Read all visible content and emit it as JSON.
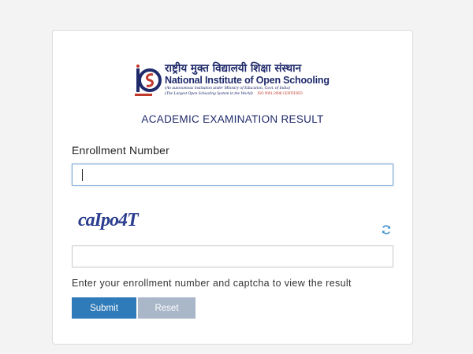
{
  "logo": {
    "hindi_name": "राष्ट्रीय मुक्त विद्यालयी शिक्षा संस्थान",
    "english_name": "National Institute of Open Schooling",
    "tagline": "(An autonomous institution under Ministry of Education, Govt. of India)",
    "tagline2": "(The Largest Open Schooling System in the World)",
    "iso": "ISO 9001:2008 CERTIFIED",
    "colors": {
      "navy": "#1f2a6b",
      "red": "#c0392b"
    }
  },
  "page": {
    "heading": "ACADEMIC EXAMINATION RESULT"
  },
  "form": {
    "enrollment_label": "Enrollment Number",
    "enrollment_value": "",
    "captcha_text": "caIpo4T",
    "captcha_value": "",
    "hint": "Enter your enrollment number and captcha to view the result",
    "submit_label": "Submit",
    "reset_label": "Reset",
    "refresh_icon": "refresh-icon",
    "colors": {
      "submit": "#2f7ab8",
      "reset": "#a9b7c9"
    }
  }
}
